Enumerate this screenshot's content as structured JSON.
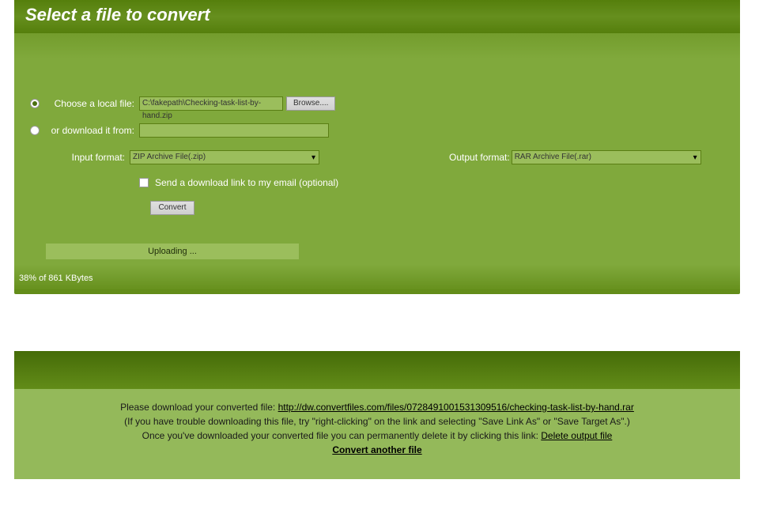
{
  "header": {
    "title": "Select a file to convert"
  },
  "form": {
    "choose_label": "Choose a local file:",
    "download_label": "or download it from:",
    "file_value": "C:\\fakepath\\Checking-task-list-by-hand.zip",
    "url_value": "",
    "browse_label": "Browse....",
    "input_format_label": "Input format:",
    "input_format_value": "ZIP Archive File(.zip)",
    "output_format_label": "Output format:",
    "output_format_value": "RAR Archive File(.rar)",
    "email_label": "Send a download link to my email (optional)",
    "convert_label": "Convert"
  },
  "upload": {
    "bar_text": "Uploading ...",
    "status": "38% of 861 KBytes"
  },
  "result": {
    "line1_prefix": "Please download your converted file: ",
    "download_url": "http://dw.convertfiles.com/files/0728491001531309516/checking-task-list-by-hand.rar",
    "line2": "(If you have trouble downloading this file, try \"right-clicking\" on the link and selecting \"Save Link As\" or \"Save Target As\".)",
    "line3_prefix": "Once you've downloaded your converted file you can permanently delete it by clicking this link: ",
    "delete_link": "Delete output file",
    "convert_another": "Convert another file"
  }
}
